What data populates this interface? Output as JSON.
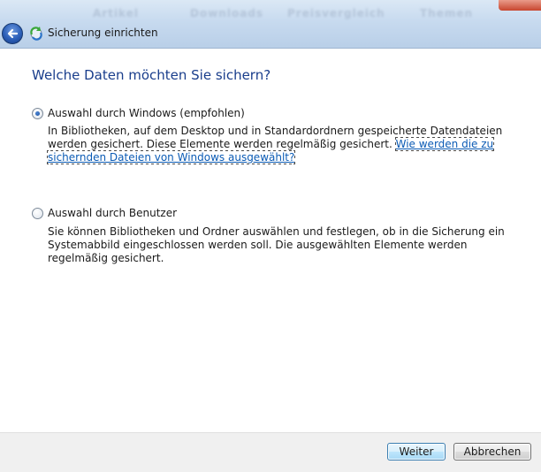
{
  "window": {
    "title": "Sicherung einrichten",
    "background_blur": [
      "Artikel",
      "Downloads",
      "Preisvergleich",
      "Themen"
    ]
  },
  "icons": {
    "back": "back-arrow-icon",
    "app": "backup-icon"
  },
  "page": {
    "heading": "Welche Daten möchten Sie sichern?"
  },
  "options": [
    {
      "label": "Auswahl durch Windows (empfohlen)",
      "selected": true,
      "description": "In Bibliotheken, auf dem Desktop und in Standardordnern gespeicherte Datendateien werden gesichert. Diese Elemente werden regelmäßig gesichert. ",
      "link": "Wie werden die zu sichernden Dateien von Windows ausgewählt?"
    },
    {
      "label": "Auswahl durch Benutzer",
      "selected": false,
      "description": "Sie können Bibliotheken und Ordner auswählen und festlegen, ob in die Sicherung ein Systemabbild eingeschlossen werden soll. Die ausgewählten Elemente werden regelmäßig gesichert."
    }
  ],
  "buttons": {
    "next": "Weiter",
    "cancel": "Abbrechen"
  },
  "colors": {
    "heading": "#1a3e8c",
    "link": "#0b5bb5",
    "footer": "#f0f0f0"
  }
}
